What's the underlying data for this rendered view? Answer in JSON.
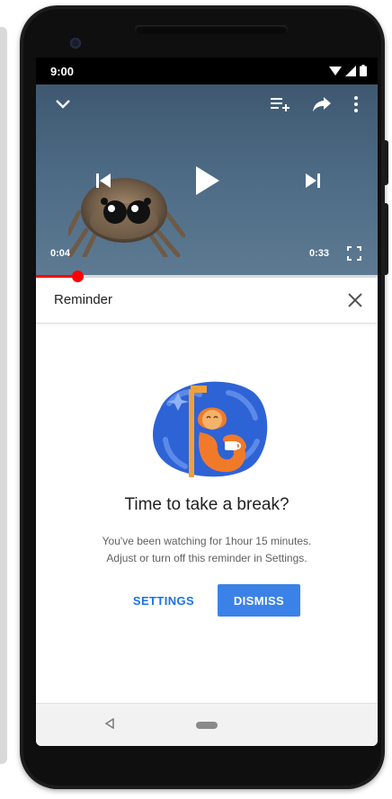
{
  "status_bar": {
    "time": "9:00",
    "icons": [
      "wifi-icon",
      "cell-signal-icon",
      "battery-icon"
    ]
  },
  "video_player": {
    "top_icons": [
      "collapse-chevron-icon",
      "add-to-queue-icon",
      "share-icon",
      "more-vert-icon"
    ],
    "center_icons": [
      "previous-icon",
      "play-icon",
      "next-icon"
    ],
    "current_time": "0:04",
    "duration": "0:33",
    "progress_fraction": 0.12,
    "fullscreen_icon": "fullscreen-icon"
  },
  "reminder": {
    "title": "Reminder",
    "close_icon": "close-icon"
  },
  "break_dialog": {
    "heading": "Time to take a break?",
    "message_line1": "You've been watching for 1hour 15 minutes.",
    "message_line2": "Adjust or turn off this reminder in Settings.",
    "settings_label": "SETTINGS",
    "dismiss_label": "DISMISS"
  },
  "nav_bar": {
    "icons": [
      "back-icon",
      "home-pill-icon"
    ]
  },
  "colors": {
    "accent": "#1a73e8",
    "dismiss_button": "#3b82e8",
    "progress": "#ff0000",
    "illustration_blue": "#2e63d6",
    "illustration_orange": "#f07a2a"
  }
}
